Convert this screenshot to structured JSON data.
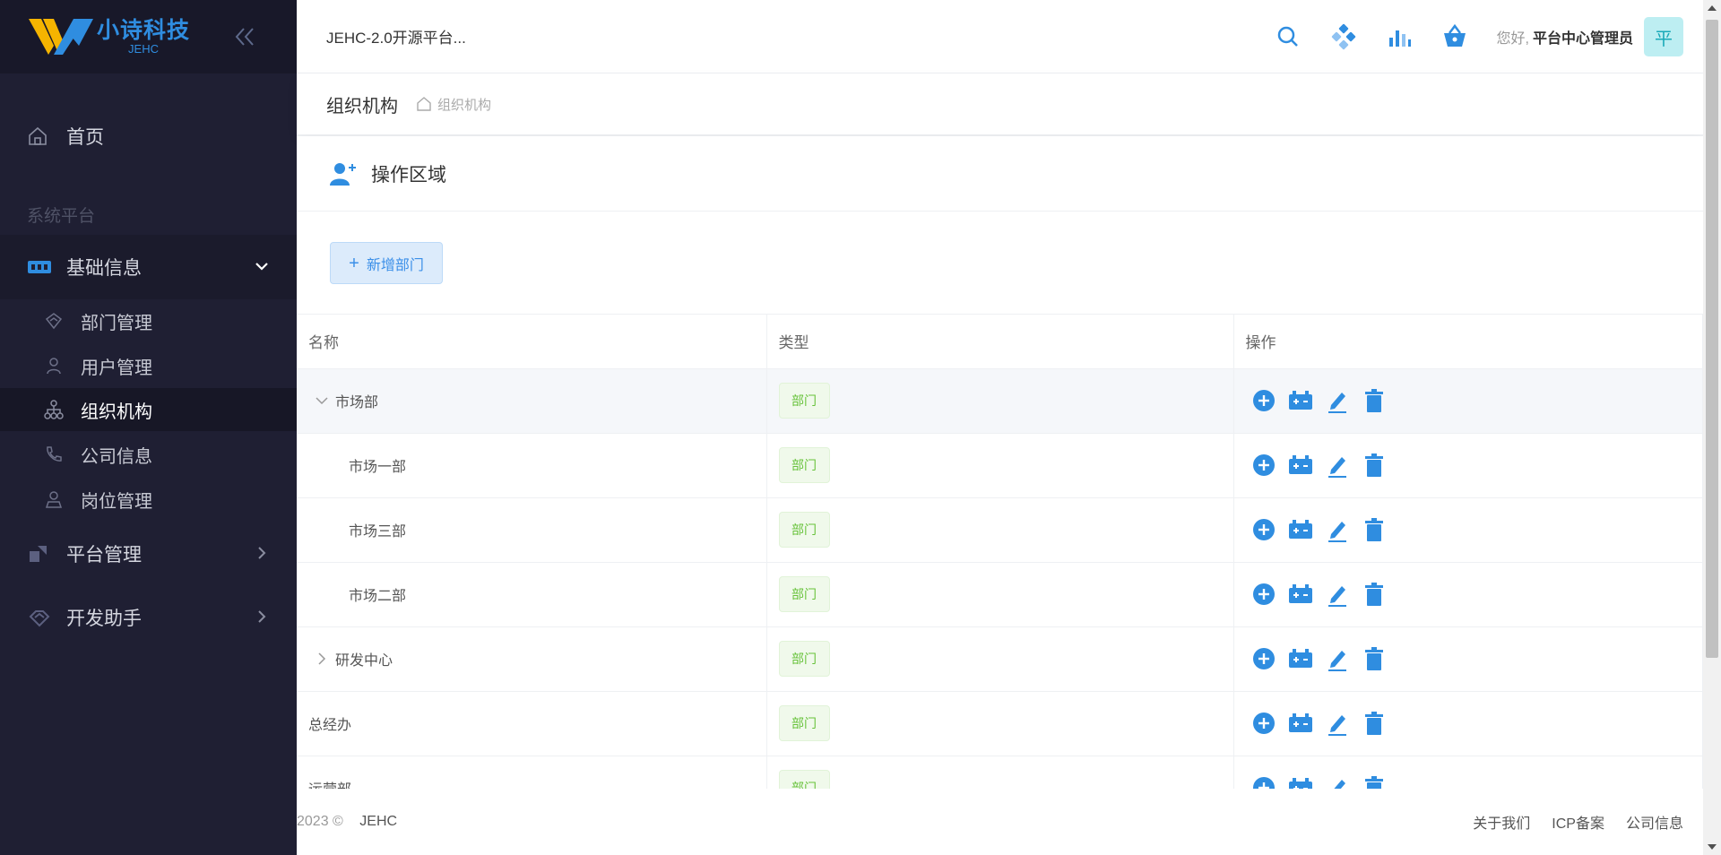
{
  "logo": {
    "title": "小诗科技",
    "subtitle": "JEHC"
  },
  "sidebar": {
    "home": "首页",
    "section": "系统平台",
    "groups": [
      {
        "label": "基础信息",
        "items": [
          "部门管理",
          "用户管理",
          "组织机构",
          "公司信息",
          "岗位管理"
        ]
      },
      {
        "label": "平台管理"
      },
      {
        "label": "开发助手"
      }
    ]
  },
  "header": {
    "title": "JEHC-2.0开源平台...",
    "greeting": "您好,",
    "user": "平台中心管理员",
    "avatar": "平"
  },
  "breadcrumb": {
    "title": "组织机构",
    "link": "组织机构"
  },
  "card": {
    "title": "操作区域",
    "add_button": "新增部门"
  },
  "table": {
    "columns": [
      "名称",
      "类型",
      "操作"
    ],
    "rows": [
      {
        "name": "市场部",
        "type": "部门"
      },
      {
        "name": "市场一部",
        "type": "部门"
      },
      {
        "name": "市场三部",
        "type": "部门"
      },
      {
        "name": "市场二部",
        "type": "部门"
      },
      {
        "name": "研发中心",
        "type": "部门"
      },
      {
        "name": "总经办",
        "type": "部门"
      },
      {
        "name": "运营部",
        "type": "部门"
      }
    ]
  },
  "footer": {
    "year": "2023",
    "copyright": "©",
    "brand": "JEHC",
    "links": [
      "关于我们",
      "ICP备案",
      "公司信息"
    ]
  },
  "colors": {
    "accent": "#3b8fe8",
    "sidebar_bg": "#1f1f33",
    "tag_green": "#67c23a"
  },
  "icons": {
    "header": [
      "search-icon",
      "apps-icon",
      "chart-icon",
      "basket-icon"
    ],
    "row_actions": [
      "add-circle-icon",
      "battery-icon",
      "edit-icon",
      "delete-icon"
    ]
  }
}
